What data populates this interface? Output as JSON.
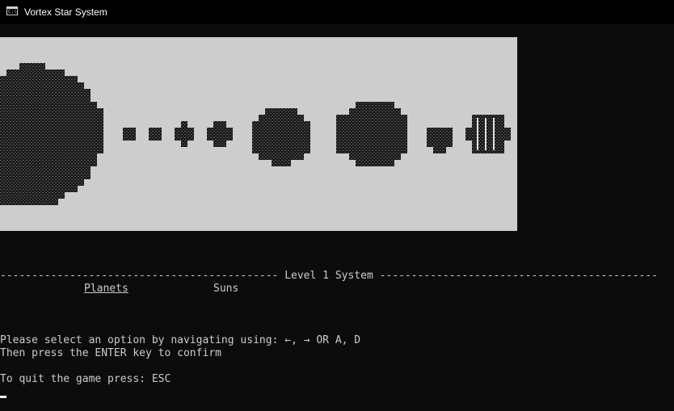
{
  "window": {
    "title": "Vortex Star System",
    "icon": "console-app-icon",
    "icon_text": "C:\\"
  },
  "art": {
    "background": "#cdcdcd",
    "shape_color": "#111111",
    "bodies": [
      "sun",
      "planet-1",
      "planet-2",
      "planet-3",
      "planet-4",
      "planet-5",
      "planet-6",
      "planet-7",
      "planet-8"
    ]
  },
  "console": {
    "header": "-------------------------------------------- Level 1 System --------------------------------------------",
    "menu": {
      "planets_label": "Planets",
      "suns_label": "Suns",
      "selected": "Planets"
    },
    "instruction_1": "Please select an option by navigating using: ←, → OR A, D",
    "instruction_2": "Then press the ENTER key to confirm",
    "quit_text": "To quit the game press: ESC"
  }
}
